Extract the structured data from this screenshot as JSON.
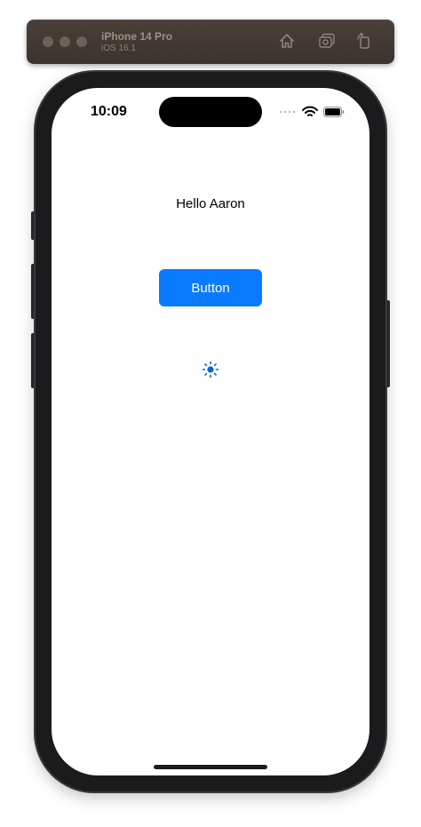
{
  "simulator": {
    "device_name": "iPhone 14 Pro",
    "os_version": "iOS 16.1",
    "toolbar_color": "#3f3631",
    "icons": [
      "home-icon",
      "screenshot-icon",
      "rotate-icon"
    ]
  },
  "status_bar": {
    "time": "10:09",
    "icons": [
      "signal-icon",
      "wifi-icon",
      "battery-icon"
    ]
  },
  "app": {
    "greeting": "Hello Aaron",
    "button_label": "Button",
    "button_color": "#0a7aff",
    "indicator_icon": "activity-indicator-icon"
  }
}
